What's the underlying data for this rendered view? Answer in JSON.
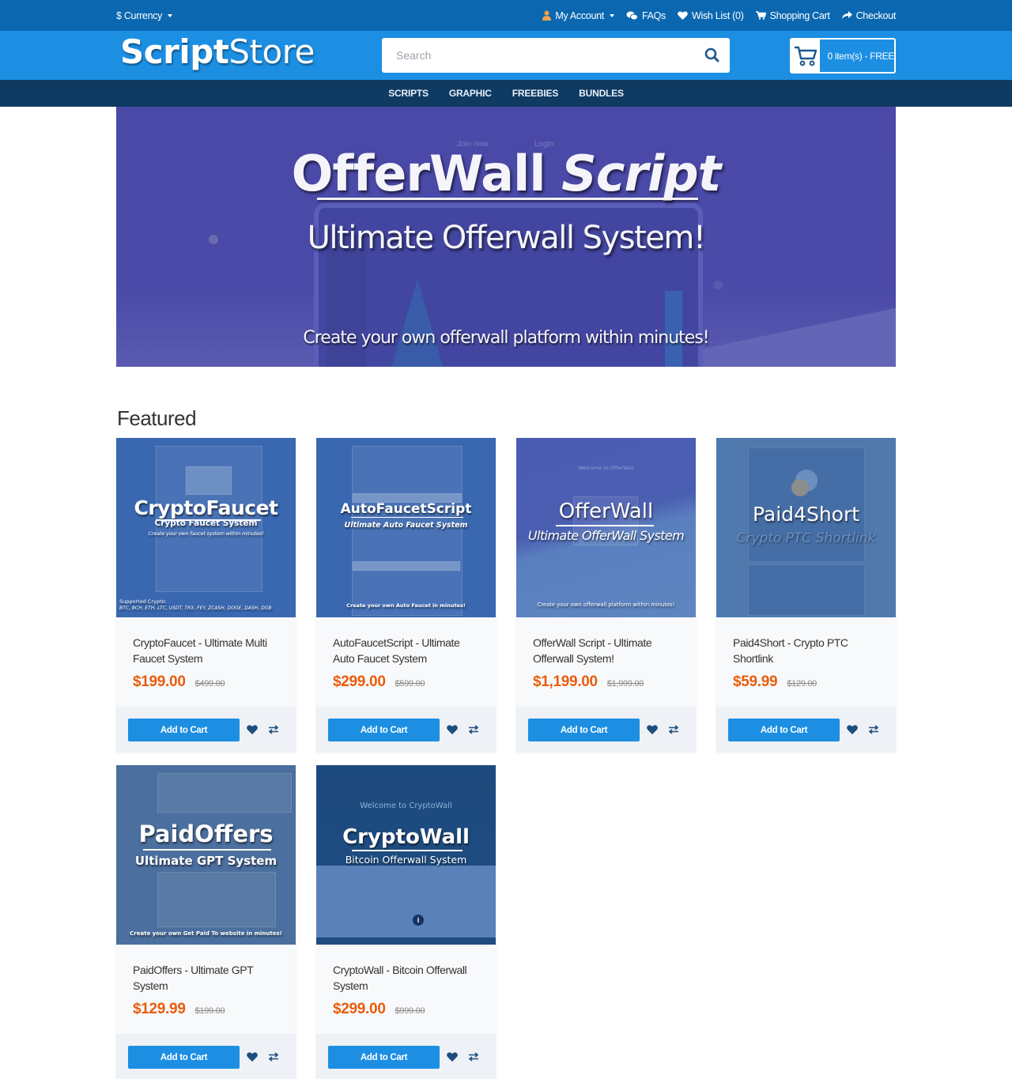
{
  "topbar": {
    "currency_label": "$ Currency",
    "links": [
      {
        "label": "My Account",
        "icon": "user-icon",
        "has_dropdown": true
      },
      {
        "label": "FAQs",
        "icon": "chat-bubbles-icon"
      },
      {
        "label": "Wish List (0)",
        "icon": "heart-icon"
      },
      {
        "label": "Shopping Cart",
        "icon": "cart-icon"
      },
      {
        "label": "Checkout",
        "icon": "share-arrow-icon"
      }
    ]
  },
  "header": {
    "logo_bold": "Script",
    "logo_thin": "Store",
    "search_placeholder": "Search",
    "cart_label": "0 item(s) - FREE"
  },
  "nav": {
    "items": [
      "SCRIPTS",
      "GRAPHIC",
      "FREEBIES",
      "BUNDLES"
    ]
  },
  "banner": {
    "mini_join": "Join now",
    "mini_login": "Login",
    "title_regular": "OfferWall ",
    "title_italic": "Script",
    "subtitle": "Ultimate Offerwall System!",
    "tagline": "Create your own offerwall platform within minutes!"
  },
  "featured": {
    "title": "Featured",
    "add_to_cart_label": "Add to Cart",
    "products": [
      {
        "name": "CryptoFaucet - Ultimate Multi Faucet System",
        "price": "$199.00",
        "old_price": "$499.00",
        "thumb": {
          "title": "CryptoFaucet",
          "subtitle": "Crypto Faucet System",
          "note": "Create your own faucet system within minutes!",
          "footer_label": "Supported Crypto:",
          "footer_list": "BTC, BCH, ETH, LTC, USDT, TRX, FEY, ZCASH, DOGE, DASH, DGB"
        }
      },
      {
        "name": "AutoFaucetScript - Ultimate Auto Faucet System",
        "price": "$299.00",
        "old_price": "$599.00",
        "thumb": {
          "title": "AutoFaucetScript",
          "subtitle": "Ultimate Auto Faucet System",
          "note": "Create your own Auto Faucet in minutes!"
        }
      },
      {
        "name": "OfferWall Script - Ultimate Offerwall System!",
        "price": "$1,199.00",
        "old_price": "$1,999.00",
        "thumb": {
          "title": "OfferWall",
          "subtitle": "Ultimate OfferWall System",
          "header": "Welcome to OfferWall",
          "note": "Create your own offerwall platform within minutes!"
        }
      },
      {
        "name": "Paid4Short - Crypto PTC Shortlink",
        "price": "$59.99",
        "old_price": "$129.00",
        "thumb": {
          "title": "Paid4Short",
          "subtitle": "Crypto PTC Shortlink"
        }
      },
      {
        "name": "PaidOffers - Ultimate GPT System",
        "price": "$129.99",
        "old_price": "$199.00",
        "thumb": {
          "title": "PaidOffers",
          "subtitle": "Ultimate GPT System",
          "note": "Create your own Get Paid To website in minutes!"
        }
      },
      {
        "name": "CryptoWall - Bitcoin Offerwall System",
        "price": "$299.00",
        "old_price": "$999.00",
        "thumb": {
          "title": "CryptoWall",
          "subtitle": "Bitcoin Offerwall System",
          "header": "Welcome to CryptoWall"
        }
      }
    ]
  },
  "colors": {
    "topbar": "#0a67b0",
    "header": "#1c8fe3",
    "nav": "#0f3a62",
    "price": "#e85d0c",
    "button": "#1c8fe3",
    "banner": "#4a49a8"
  }
}
